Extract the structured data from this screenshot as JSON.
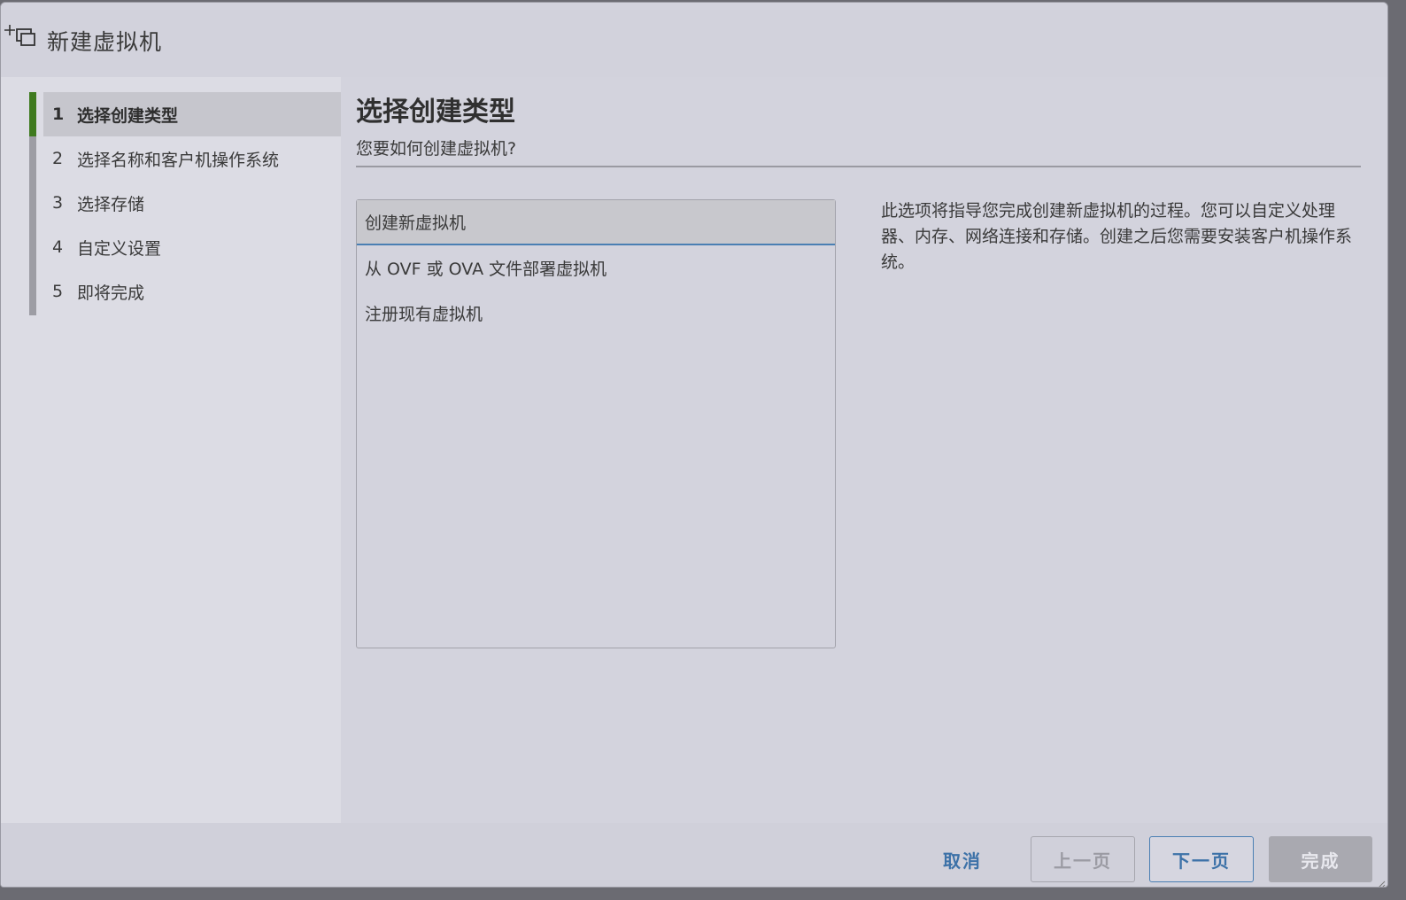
{
  "window": {
    "title": "新建虚拟机",
    "icon": "new-vm-icon"
  },
  "steps": [
    {
      "num": "1",
      "label": "选择创建类型",
      "active": true
    },
    {
      "num": "2",
      "label": "选择名称和客户机操作系统",
      "active": false
    },
    {
      "num": "3",
      "label": "选择存储",
      "active": false
    },
    {
      "num": "4",
      "label": "自定义设置",
      "active": false
    },
    {
      "num": "5",
      "label": "即将完成",
      "active": false
    }
  ],
  "main": {
    "title": "选择创建类型",
    "subtitle": "您要如何创建虚拟机?",
    "options": [
      {
        "label": "创建新虚拟机",
        "selected": true
      },
      {
        "label": "从 OVF 或 OVA 文件部署虚拟机",
        "selected": false
      },
      {
        "label": "注册现有虚拟机",
        "selected": false
      }
    ],
    "description": "此选项将指导您完成创建新虚拟机的过程。您可以自定义处理器、内存、网络连接和存储。创建之后您需要安装客户机操作系统。"
  },
  "footer": {
    "cancel_label": "取消",
    "prev_label": "上一页",
    "next_label": "下一页",
    "finish_label": "完成"
  },
  "colors": {
    "active_step_bar": "#3f7a1f",
    "link_blue": "#3d72a8",
    "selection_underline": "#4a7fb3"
  }
}
